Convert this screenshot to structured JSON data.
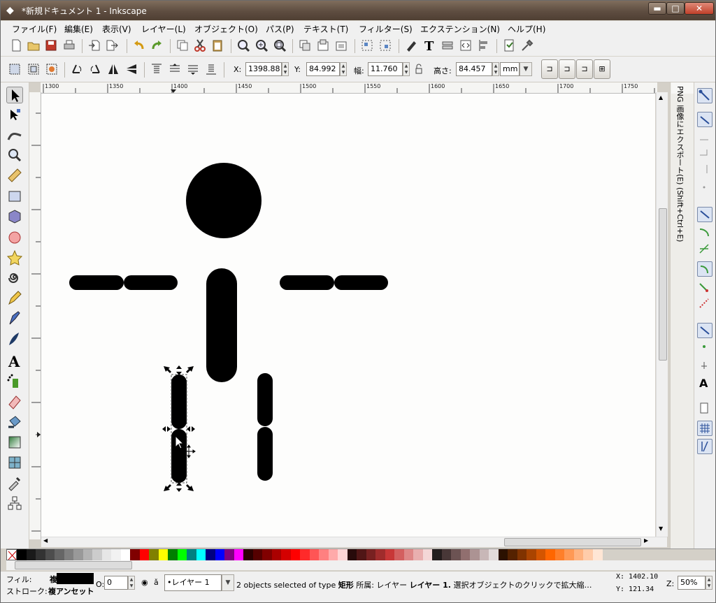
{
  "window": {
    "title": "*新規ドキュメント 1 - Inkscape",
    "min_label": "▬",
    "max_label": "□",
    "close_label": "✕"
  },
  "menu": [
    "ファイル(F)",
    "編集(E)",
    "表示(V)",
    "レイヤー(L)",
    "オブジェクト(O)",
    "パス(P)",
    "テキスト(T)",
    "フィルター(S)",
    "エクステンション(N)",
    "ヘルプ(H)"
  ],
  "selector_toolbar": {
    "x_label": "X:",
    "x_value": "1398.88",
    "y_label": "Y:",
    "y_value": "84.992",
    "w_label": "幅:",
    "w_value": "11.760",
    "h_label": "高さ:",
    "h_value": "84.457",
    "unit": "mm"
  },
  "ruler": {
    "ticks": [
      "1300",
      "1350",
      "1400",
      "1450",
      "1500",
      "1550",
      "1600",
      "1650",
      "1700",
      "1750"
    ]
  },
  "dock": {
    "export_tab_label": "PNG 画像にエクスポート(E) (Shift+Ctrl+E)"
  },
  "palette": {
    "colors": [
      "#000000",
      "#1a1a1a",
      "#333333",
      "#4d4d4d",
      "#666666",
      "#808080",
      "#999999",
      "#b3b3b3",
      "#cccccc",
      "#e6e6e6",
      "#f2f2f2",
      "#ffffff",
      "#800000",
      "#ff0000",
      "#808000",
      "#ffff00",
      "#008000",
      "#00ff00",
      "#008080",
      "#00ffff",
      "#000080",
      "#0000ff",
      "#800080",
      "#ff00ff",
      "#2b0000",
      "#550000",
      "#800000",
      "#aa0000",
      "#d40000",
      "#ff0000",
      "#ff2a2a",
      "#ff5555",
      "#ff8080",
      "#ffaaaa",
      "#ffd5d5",
      "#280b0b",
      "#501616",
      "#782121",
      "#a02c2c",
      "#c83737",
      "#d35f5f",
      "#de8787",
      "#e9afaf",
      "#f4d7d7",
      "#241c1c",
      "#483737",
      "#6c5353",
      "#916f6f",
      "#ac9393",
      "#c8b7b7",
      "#e3dbdb",
      "#2b1100",
      "#552200",
      "#803300",
      "#aa4400",
      "#d45500",
      "#ff6600",
      "#ff7f2a",
      "#ff9955",
      "#ffb380",
      "#ffccaa",
      "#ffe6d5"
    ]
  },
  "status": {
    "fill_label": "フィル:",
    "fill_value": "複",
    "stroke_label": "ストローク:",
    "stroke_value": "複アンセット",
    "opacity_label": "O:",
    "opacity_value": "0",
    "layer_value": "•レイヤー 1",
    "message_prefix": "2 objects selected of type",
    "message_type": "矩形",
    "message_in": "所属: レイヤー",
    "message_layer": "レイヤー 1.",
    "message_tail": "選択オブジェクトのクリックで拡大縮…",
    "cursor_x": "X: 1402.10",
    "cursor_y": "Y:  121.34",
    "zoom_label": "Z:",
    "zoom_value": "50%"
  }
}
